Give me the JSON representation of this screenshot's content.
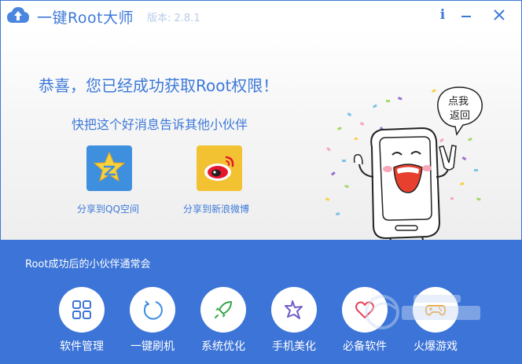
{
  "titlebar": {
    "title": "一键Root大师",
    "version": "版本: 2.8.1",
    "info_glyph": "i",
    "icons": [
      "app-logo-icon",
      "info-icon",
      "minimize-icon",
      "close-icon"
    ]
  },
  "main": {
    "congrats_text": "恭喜，您已经成功获取Root权限！",
    "share_hint": "快把这个好消息告诉其他小伙伴",
    "share_items": [
      {
        "label": "分享到QQ空间",
        "icon": "qzone-star-icon"
      },
      {
        "label": "分享到新浪微博",
        "icon": "weibo-eye-icon"
      }
    ],
    "mascot_bubble": [
      "点我",
      "返回"
    ]
  },
  "band": {
    "title": "Root成功后的小伙伴通常会",
    "tools": [
      {
        "label": "软件管理",
        "icon": "grid-icon"
      },
      {
        "label": "一键刷机",
        "icon": "refresh-icon"
      },
      {
        "label": "系统优化",
        "icon": "rocket-icon"
      },
      {
        "label": "手机美化",
        "icon": "star-icon"
      },
      {
        "label": "必备软件",
        "icon": "heart-icon"
      },
      {
        "label": "火爆游戏",
        "icon": "gamepad-icon"
      }
    ]
  },
  "colors": {
    "accent": "#3d79d9",
    "band": "#3c74d7",
    "qzone_tile": "#3f8fdf",
    "weibo_tile": "#f3c232"
  }
}
